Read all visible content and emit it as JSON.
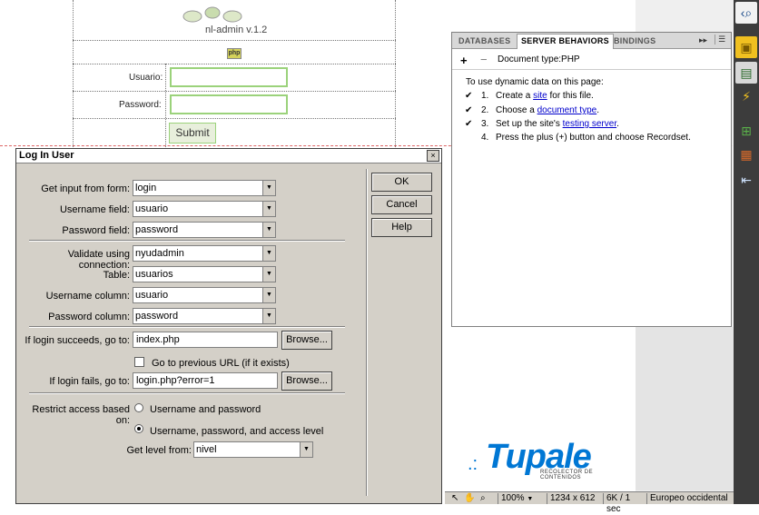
{
  "background_page": {
    "logo_text": "nl-admin v.1.2",
    "php_badge": "php",
    "usuario_label": "Usuario:",
    "password_label": "Password:",
    "submit_label": "Submit"
  },
  "panel": {
    "tabs": [
      {
        "label": "DATABASES"
      },
      {
        "label": "SERVER BEHAVIORS"
      },
      {
        "label": "BINDINGS"
      }
    ],
    "arrows": "▸▸",
    "plus": "+",
    "minus": "−",
    "doc_type": "Document type:PHP",
    "intro": "To use dynamic data on this page:",
    "steps": [
      {
        "check": "✔",
        "num": "1.",
        "pre": "Create a ",
        "link": "site",
        "post": " for this file."
      },
      {
        "check": "✔",
        "num": "2.",
        "pre": "Choose a ",
        "link": "document type",
        "post": "."
      },
      {
        "check": "✔",
        "num": "3.",
        "pre": "Set up the site's ",
        "link": "testing server",
        "post": "."
      },
      {
        "check": "",
        "num": "4.",
        "pre": "Press the plus (+) button and choose Recordset.",
        "link": "",
        "post": ""
      }
    ]
  },
  "dialog": {
    "title": "Log In User",
    "close": "×",
    "fields": {
      "get_input_label": "Get input from form:",
      "get_input_value": "login",
      "username_field_label": "Username field:",
      "username_field_value": "usuario",
      "password_field_label": "Password field:",
      "password_field_value": "password",
      "validate_label": "Validate using connection:",
      "validate_value": "nyudadmin",
      "table_label": "Table:",
      "table_value": "usuarios",
      "username_col_label": "Username column:",
      "username_col_value": "usuario",
      "password_col_label": "Password column:",
      "password_col_value": "password",
      "succeeds_label": "If login succeeds, go to:",
      "succeeds_value": "index.php",
      "previous_url_label": "Go to previous URL (if it exists)",
      "fails_label": "If login fails, go to:",
      "fails_value": "login.php?error=1",
      "restrict_label": "Restrict access based on:",
      "radio_1_label": "Username and password",
      "radio_2_label": "Username, password, and access level",
      "level_label": "Get level from:",
      "level_value": "nivel"
    },
    "buttons": {
      "ok": "OK",
      "cancel": "Cancel",
      "help": "Help",
      "browse": "Browse..."
    }
  },
  "tupale": {
    "name": "Tupale",
    "dots": ".:",
    "subtitle": "RECOLECTOR DE CONTENIDOS"
  },
  "statusbar": {
    "zoom": "100%",
    "size": "1234 x 612",
    "download": "6K / 1 sec",
    "encoding": "Europeo occidental"
  },
  "colors": {
    "accent_green": "#9bd27b",
    "link_blue": "#0000cc",
    "tupale_blue": "#0077d4"
  }
}
